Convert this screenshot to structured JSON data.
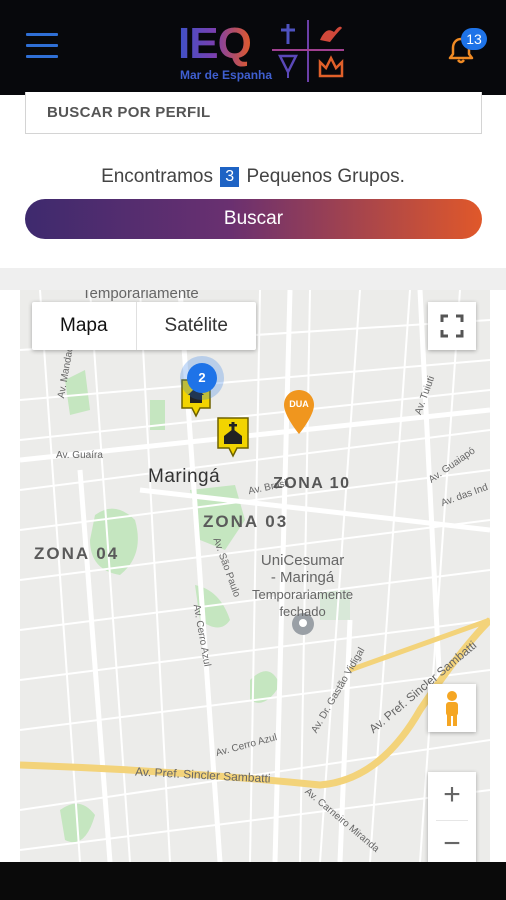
{
  "header": {
    "logo_text": "IEQ",
    "logo_subtitle": "Mar de Espanha",
    "notification_count": "13",
    "colors": {
      "bar_bg": "#07080c",
      "menu": "#2f6fd6",
      "bell": "#f08a24",
      "badge": "#1e73e8"
    }
  },
  "search": {
    "placeholder": "BUSCAR POR PERFIL",
    "value": ""
  },
  "results": {
    "prefix": "Encontramos",
    "count": "3",
    "suffix": "Pequenos Grupos."
  },
  "buscar_button": {
    "label": "Buscar",
    "gradient": [
      "#3e2a6e",
      "#e0582a"
    ]
  },
  "map": {
    "type_buttons": [
      "Mapa",
      "Satélite"
    ],
    "active_type": "Mapa",
    "city": "Maringá",
    "zones": [
      "ZONA 10",
      "ZONA 03",
      "ZONA 04"
    ],
    "poi": [
      "UniCesumar",
      "- Maringá",
      "Temporariamente",
      "fechado"
    ],
    "poi_top": "Temporariamente",
    "streets": [
      "Av. Guaíra",
      "Av. Brasil",
      "Av. Tuiuti",
      "Av. Guaiapó",
      "Av. das Ind",
      "Av. Mandacarú",
      "Av. São Paulo",
      "Av. Cerro Azul",
      "Av. Dr. Gastão Vidigal",
      "Av. Pref. Sincler Sambatti",
      "Av. Carneiro Miranda"
    ],
    "cluster_count": "2",
    "orange_pin_label": "DUA",
    "zoom_in": "+",
    "zoom_out": "−",
    "colors": {
      "map_bg": "#ececea",
      "road": "#ffffff",
      "highway": "#f3d37a",
      "park": "#c5e6c0",
      "cluster": "#1e73e8",
      "pin_yellow": "#f2d400",
      "pin_orange": "#f0961e"
    }
  }
}
